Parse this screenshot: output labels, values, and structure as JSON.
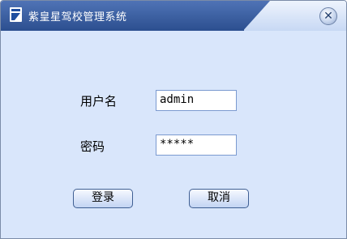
{
  "window": {
    "title": "紫皇星驾校管理系统"
  },
  "form": {
    "username_label": "用户名",
    "username_value": "admin",
    "password_label": "密码",
    "password_value": "*****"
  },
  "buttons": {
    "login": "登录",
    "cancel": "取消"
  },
  "icons": {
    "app": "app-logo-icon",
    "close": "close-icon"
  },
  "colors": {
    "title_bar": "#2c4f8f",
    "background": "#d9e6fb",
    "button_border": "#3f5f93"
  }
}
